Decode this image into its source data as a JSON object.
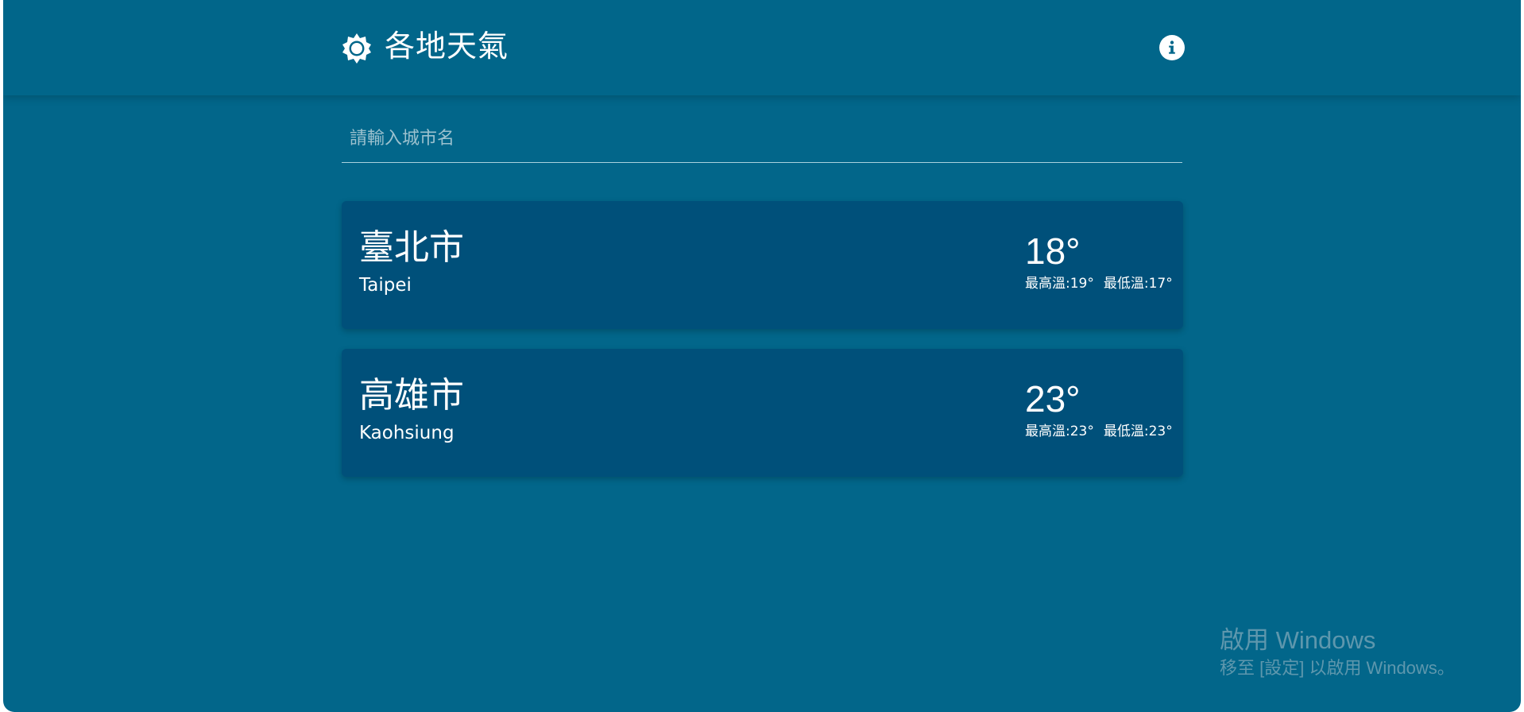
{
  "header": {
    "title": "各地天氣",
    "app_icon": "sun-icon",
    "info_icon": "info-icon"
  },
  "search": {
    "placeholder": "請輸入城市名",
    "value": ""
  },
  "cities": [
    {
      "name_zh": "臺北市",
      "name_en": "Taipei",
      "temp": "18°",
      "max": "最高溫:19°",
      "min": "最低溫:17°"
    },
    {
      "name_zh": "高雄市",
      "name_en": "Kaohsiung",
      "temp": "23°",
      "max": "最高溫:23°",
      "min": "最低溫:23°"
    }
  ],
  "watermark": {
    "title": "啟用 Windows",
    "subtitle": "移至 [設定] 以啟用 Windows。"
  },
  "colors": {
    "background": "#02668a",
    "card": "#00507a",
    "text": "#ffffff",
    "placeholder": "#9cc1ce",
    "watermark": "#5e97ad"
  }
}
